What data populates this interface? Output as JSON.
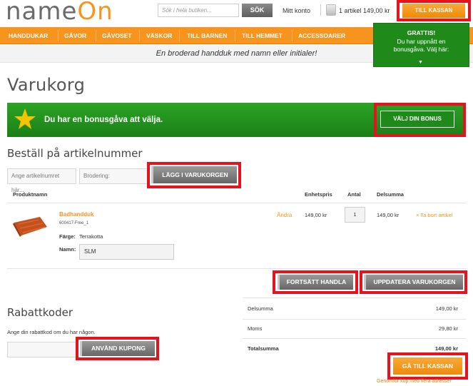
{
  "brand": {
    "name_part1": "name",
    "name_part2": "On"
  },
  "search": {
    "placeholder": "Sök i hela butiken...",
    "button_label": "SÖK"
  },
  "header": {
    "account_label": "Mitt konto",
    "cart_summary": "1 artikel 149,00 kr",
    "checkout_label": "TILL KASSAN"
  },
  "nav": {
    "items": [
      "HANDDUKAR",
      "GÅVOR",
      "GÅVOSET",
      "VÄSKOR",
      "TILL BARNEN",
      "TILL HEMMET",
      "ACCESSOARER"
    ]
  },
  "subbar": {
    "text": "En broderad handduk med namn eller initialer!"
  },
  "bonus_popup": {
    "title": "GRATTIS!",
    "line1": "Du har uppnått en",
    "line2": "bonusgåva. Välj här:",
    "arrow": "▼"
  },
  "page": {
    "title": "Varukorg"
  },
  "bonus_banner": {
    "text": "Du har en bonusgåva att välja.",
    "button_label": "VÄLJ DIN BONUS"
  },
  "order_by_sku": {
    "title": "Beställ på artikelnummer",
    "sku_placeholder": "Ange artikelnumret här...",
    "embroidery_placeholder": "Brodering:",
    "add_button": "LÄGG I VARUKORGEN"
  },
  "cart_table": {
    "headers": {
      "product": "Produktnamn",
      "unit_price": "Enhetspris",
      "qty": "Antal",
      "subtotal": "Delsumma"
    },
    "items": [
      {
        "name": "Badhandduk",
        "sku": "600417-Free_1",
        "edit": "Ändra",
        "color_label": "Färge:",
        "color_value": "Terrakotta",
        "name_label": "Namn:",
        "name_value": "SLM",
        "unit_price": "149,00 kr",
        "qty": "1",
        "line_total": "149,00 kr",
        "remove": "× Ta bort artikel"
      }
    ]
  },
  "cart_actions": {
    "continue_label": "FORTSÄTT HANDLA",
    "update_label": "UPPDATERA VARUKORGEN"
  },
  "coupon": {
    "title": "Rabattkoder",
    "hint": "Ange din rabattkod om du har någon.",
    "button_label": "ANVÄND KUPONG"
  },
  "totals": {
    "subtotal_label": "Delsumma",
    "subtotal_value": "149,00 kr",
    "tax_label": "Moms",
    "tax_value": "29,80 kr",
    "grand_label": "Totalsumma",
    "grand_value": "149,00 kr"
  },
  "checkout": {
    "button_label": "GÅ TILL KASSAN",
    "multi_address": "Genomför köp med flera adresser"
  },
  "colors": {
    "accent": "#f7941d",
    "green": "#1f8a1a",
    "highlight": "#e4131d"
  }
}
